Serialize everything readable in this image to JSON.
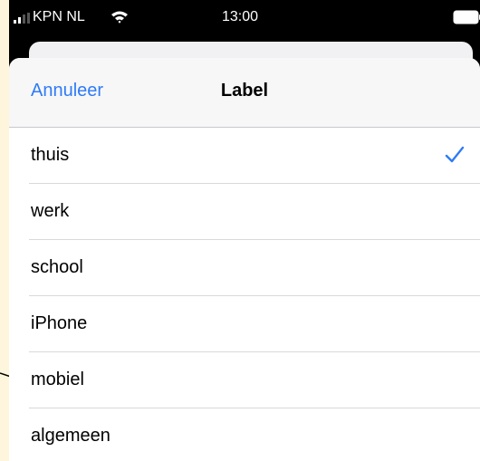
{
  "status_bar": {
    "carrier": "KPN NL",
    "time": "13:00",
    "signal_icon": "signal-bars-icon",
    "wifi_icon": "wifi-icon",
    "battery_icon": "battery-icon"
  },
  "sheet": {
    "cancel_label": "Annuleer",
    "title": "Label"
  },
  "options": [
    {
      "label": "thuis",
      "selected": true
    },
    {
      "label": "werk",
      "selected": false
    },
    {
      "label": "school",
      "selected": false
    },
    {
      "label": "iPhone",
      "selected": false
    },
    {
      "label": "mobiel",
      "selected": false
    },
    {
      "label": "algemeen",
      "selected": false
    }
  ],
  "colors": {
    "accent": "#2f7bf6",
    "outer_background": "#fdf6dc"
  }
}
